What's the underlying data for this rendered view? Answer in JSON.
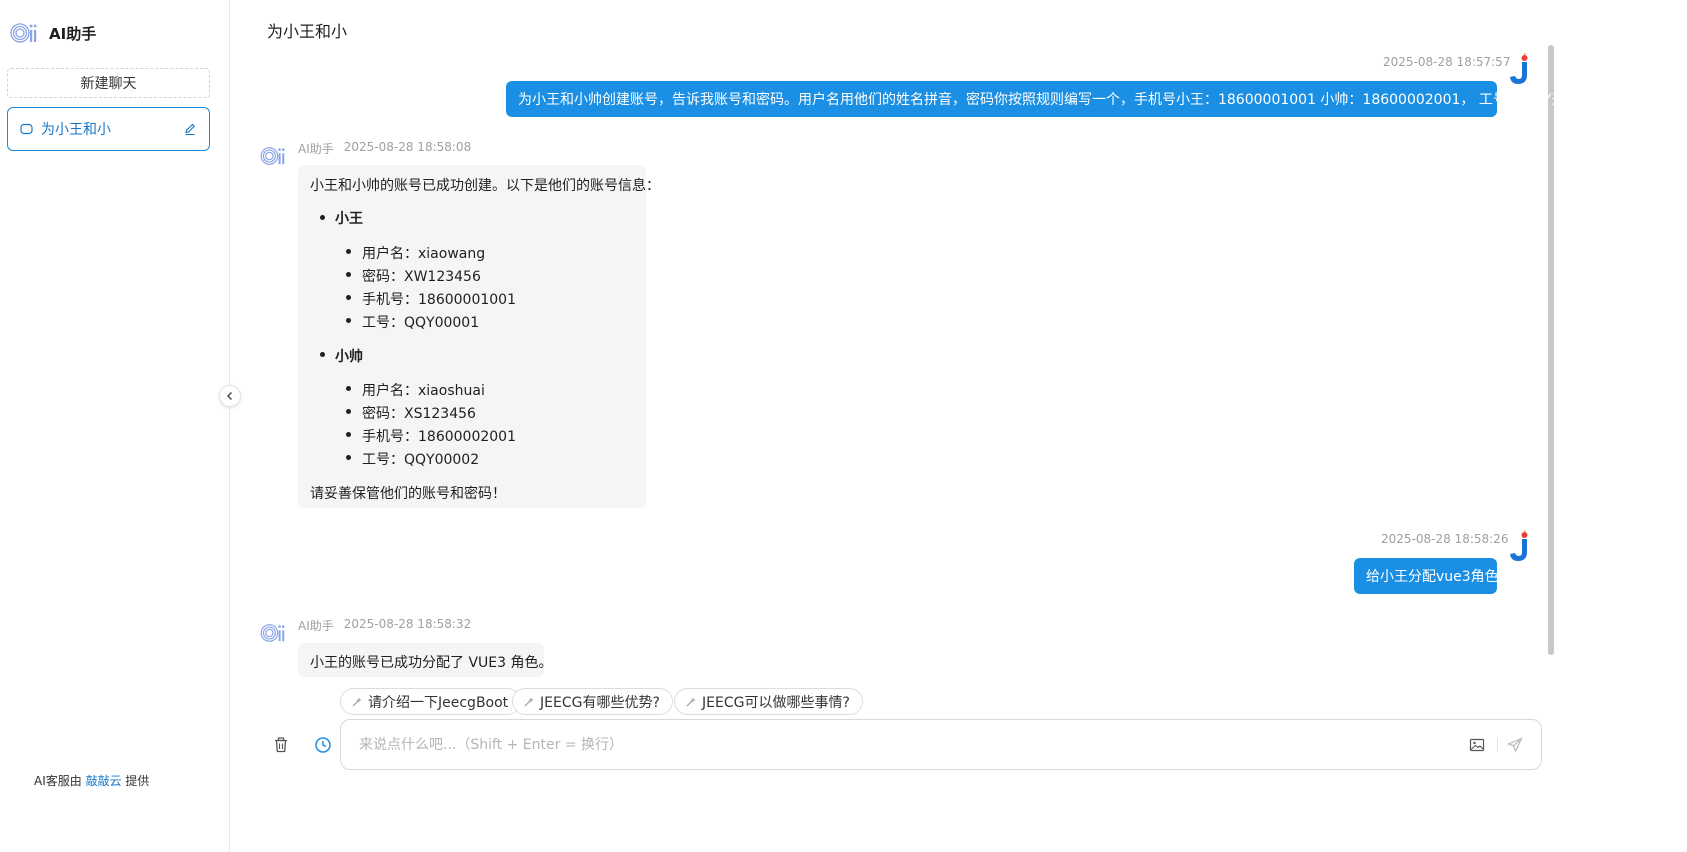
{
  "sidebar": {
    "title": "AI助手",
    "new_chat_label": "新建聊天",
    "chats": [
      {
        "label": "为小王和小"
      }
    ],
    "footer_prefix": "AI客服由",
    "footer_link": "敲敲云",
    "footer_suffix": "提供"
  },
  "conversation": {
    "title": "为小王和小",
    "ai_name": "AI助手",
    "messages": [
      {
        "role": "user",
        "time": "2025-08-28 18:57:57",
        "text": "为小王和小帅创建账号，告诉我账号和密码。用户名用他们的姓名拼音，密码你按照规则编写一个，手机号小王：18600001001 小帅：18600002001， 工号：QQY开头"
      },
      {
        "role": "ai",
        "time": "2025-08-28 18:58:08",
        "intro": "小王和小帅的账号已成功创建。以下是他们的账号信息：",
        "people": [
          {
            "name": "小王",
            "fields": [
              "用户名：xiaowang",
              "密码：XW123456",
              "手机号：18600001001",
              "工号：QQY00001"
            ]
          },
          {
            "name": "小帅",
            "fields": [
              "用户名：xiaoshuai",
              "密码：XS123456",
              "手机号：18600002001",
              "工号：QQY00002"
            ]
          }
        ],
        "outro": "请妥善保管他们的账号和密码！"
      },
      {
        "role": "user",
        "time": "2025-08-28 18:58:26",
        "text": "给小王分配vue3角色"
      },
      {
        "role": "ai",
        "time": "2025-08-28 18:58:32",
        "text": "小王的账号已成功分配了 VUE3 角色。"
      }
    ]
  },
  "suggestions": [
    "请介绍一下JeecgBoot",
    "JEECG有哪些优势?",
    "JEECG可以做哪些事情?"
  ],
  "input": {
    "placeholder": "来说点什么吧...（Shift + Enter = 换行）",
    "value": ""
  },
  "colors": {
    "accent": "#1a8fe3",
    "ai_bubble": "#f4f5f7",
    "link": "#1677c7"
  },
  "icons": {
    "logo": "ai-logo-icon",
    "chat": "chat-bubble-icon",
    "edit": "edit-icon",
    "collapse": "chevron-left-icon",
    "clear": "trash-icon",
    "history": "history-clock-icon",
    "image": "image-icon",
    "send": "send-icon",
    "suggestion": "sparkle-icon"
  }
}
